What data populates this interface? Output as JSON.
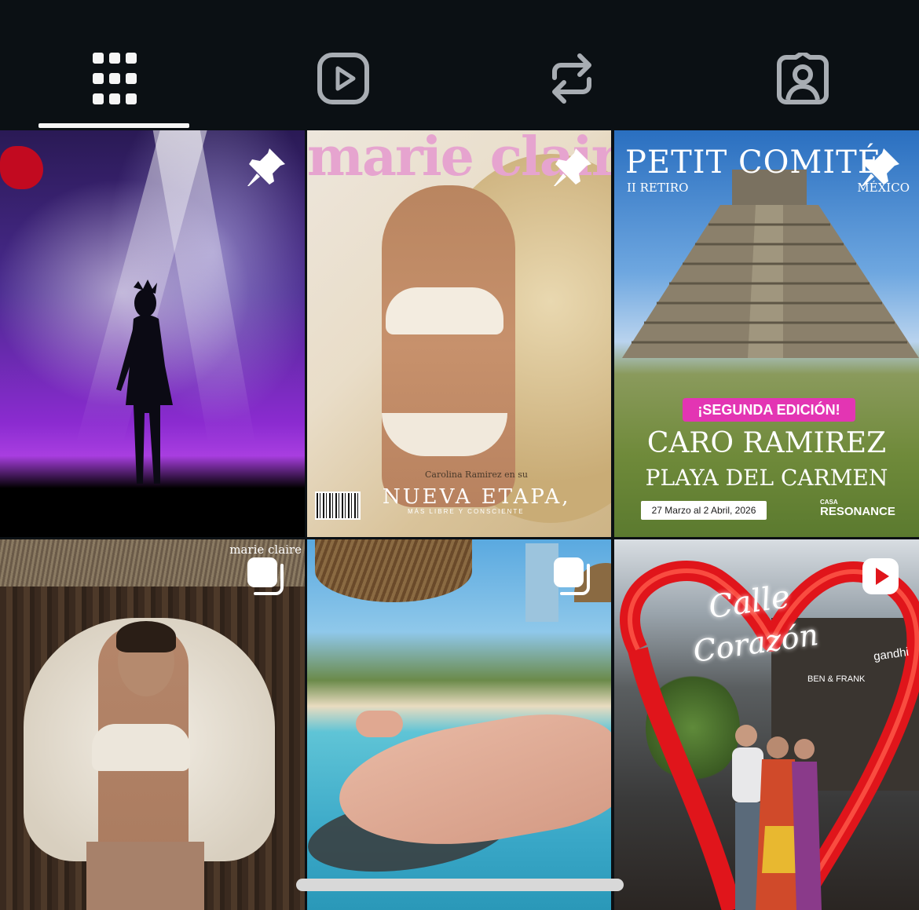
{
  "tabs": [
    {
      "name": "grid",
      "icon": "grid-icon",
      "selected": true
    },
    {
      "name": "reels",
      "icon": "reels-icon",
      "selected": false
    },
    {
      "name": "reposts",
      "icon": "repost-icon",
      "selected": false
    },
    {
      "name": "tagged",
      "icon": "tagged-icon",
      "selected": false
    }
  ],
  "posts": [
    {
      "badge": "pin-icon"
    },
    {
      "badge": "pin-icon",
      "masthead": "marie claire",
      "subline": "Carolina Ramirez en su",
      "headline": "NUEVA ETAPA,",
      "tagline": "MÁS LIBRE Y CONSCIENTE"
    },
    {
      "badge": "pin-icon",
      "title": "PETIT COMITÉ",
      "retiro": "II RETIRO",
      "country": "MÉXICO",
      "edition": "¡SEGUNDA EDICIÓN!",
      "name": "CARO RAMIREZ",
      "place": "PLAYA DEL CARMEN",
      "dates": "27 Marzo al 2 Abril, 2026",
      "brand_top": "CASA",
      "brand": "RESONANCE"
    },
    {
      "badge": "carousel-icon",
      "brand": "marie claire"
    },
    {
      "badge": "carousel-icon"
    },
    {
      "badge": "reel-icon",
      "sign_line1": "Calle",
      "sign_line2": "Corazón",
      "store1": "gandhi",
      "store2": "BEN & FRANK"
    }
  ],
  "colors": {
    "background": "#0b1014",
    "icon": "#a8adb3",
    "icon_active": "#f5f5f5"
  }
}
